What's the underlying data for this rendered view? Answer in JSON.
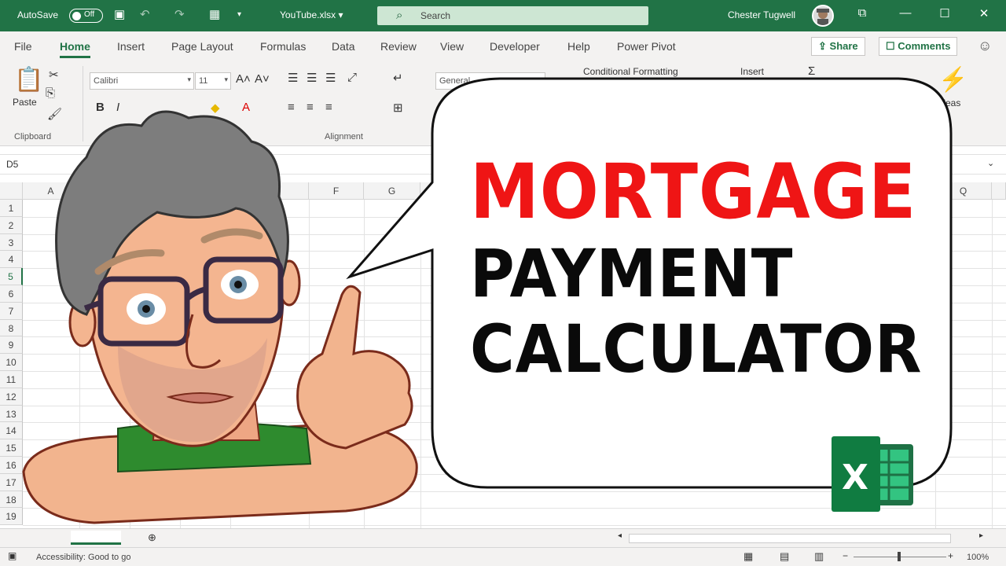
{
  "titlebar": {
    "autosave_label": "AutoSave",
    "autosave_state": "Off",
    "filename": "YouTube.xlsx",
    "search_placeholder": "Search",
    "user_name": "Chester Tugwell"
  },
  "tabs": [
    "File",
    "Home",
    "Insert",
    "Page Layout",
    "Formulas",
    "Data",
    "Review",
    "View",
    "Developer",
    "Help",
    "Power Pivot"
  ],
  "active_tab": "Home",
  "share_label": "Share",
  "comments_label": "Comments",
  "ribbon": {
    "paste_label": "Paste",
    "clipboard_label": "Clipboard",
    "font_name": "Calibri",
    "font_size": "11",
    "alignment_label": "Alignment",
    "number_format": "General",
    "conditional_formatting": "Conditional Formatting",
    "insert_label": "Insert",
    "ideas_label": "Ideas"
  },
  "formula_bar": {
    "name_box": "D5"
  },
  "grid": {
    "col_headers": [
      "A",
      "E",
      "F",
      "G",
      "Q"
    ],
    "row_headers": [
      "1",
      "2",
      "3",
      "4",
      "5",
      "6",
      "7",
      "8",
      "9",
      "10",
      "11",
      "12",
      "13",
      "14",
      "15",
      "16",
      "17",
      "18",
      "19"
    ],
    "selected_row": "5"
  },
  "status": {
    "accessibility": "Accessibility: Good to go",
    "zoom": "100%"
  },
  "thumbnail": {
    "line1": "MORTGAGE",
    "line2": "PAYMENT",
    "line3": "CALCULATOR",
    "line1_color": "#ef1515",
    "line23_color": "#0a0a0a"
  },
  "colors": {
    "excel_green": "#217346"
  }
}
